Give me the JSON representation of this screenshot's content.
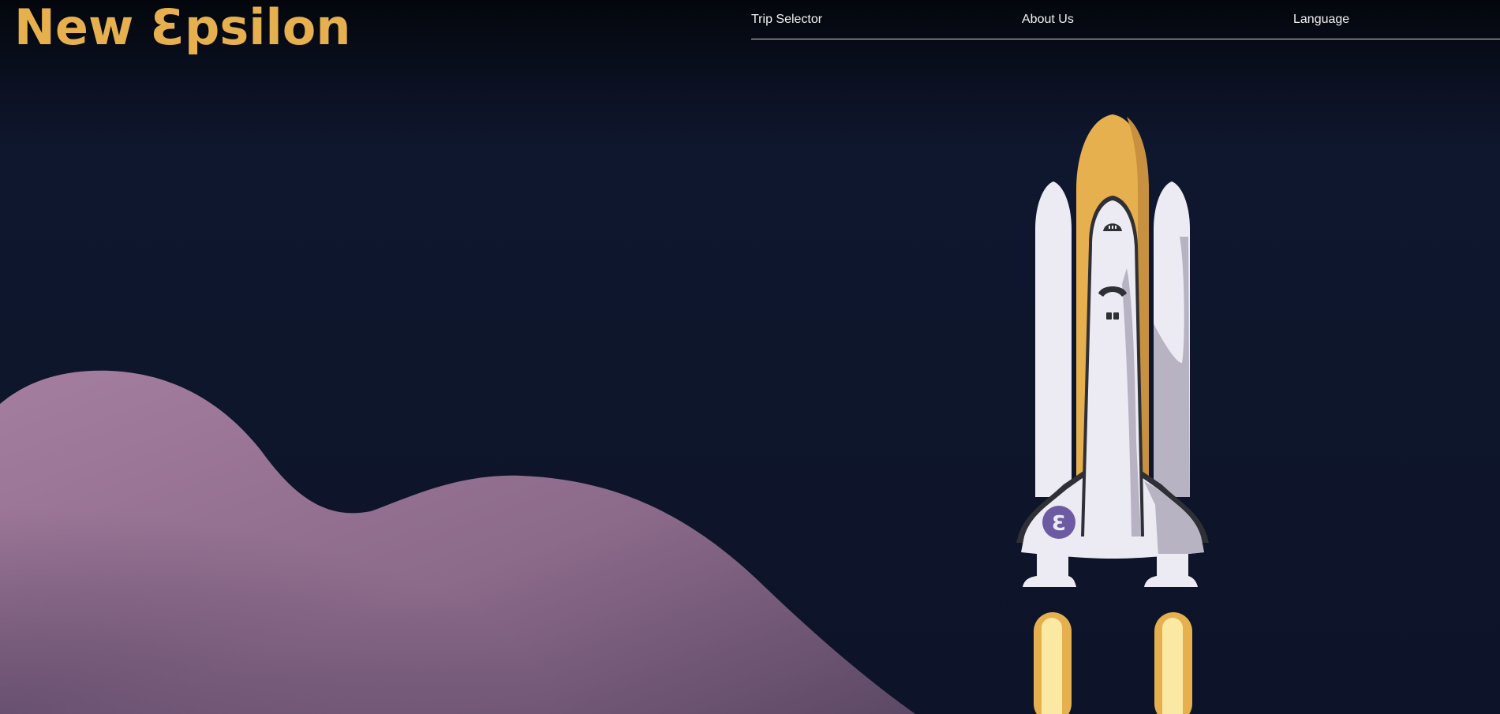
{
  "brand": {
    "name": "New Ɛpsilon",
    "color": "#e6b04e"
  },
  "nav": {
    "items": [
      {
        "label": "Trip Selector"
      },
      {
        "label": "About Us"
      },
      {
        "label": "Language"
      }
    ]
  },
  "colors": {
    "background": "#0d1429",
    "hill": "#9a7596",
    "shuttle_body": "#ecebf3",
    "external_tank": "#e6b04e",
    "booster_flame": "#fbe9a3",
    "emblem": "#6c5aa2"
  },
  "shuttle": {
    "emblem_letter": "Ɛ"
  }
}
